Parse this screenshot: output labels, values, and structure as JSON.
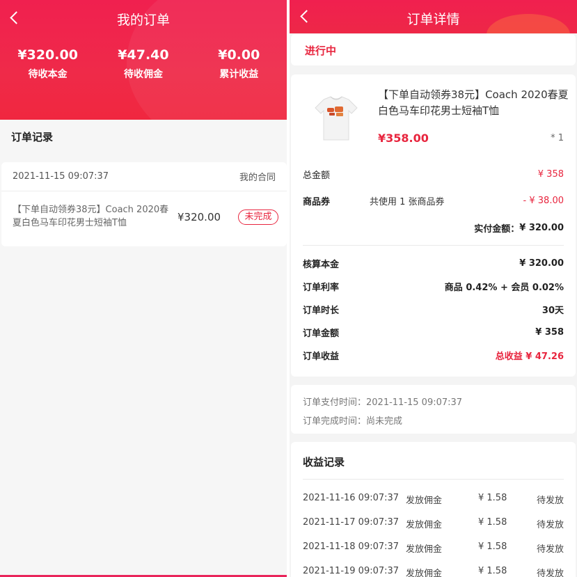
{
  "left": {
    "title": "我的订单",
    "stats": [
      {
        "value": "¥320.00",
        "label": "待收本金"
      },
      {
        "value": "¥47.40",
        "label": "待收佣金"
      },
      {
        "value": "¥0.00",
        "label": "累计收益"
      }
    ],
    "records_title": "订单记录",
    "order": {
      "time": "2021-11-15 09:07:37",
      "contract_link": "我的合同",
      "name": "【下单自动领券38元】Coach 2020春夏白色马车印花男士短袖T恤",
      "amount": "¥320.00",
      "status": "未完成"
    }
  },
  "right": {
    "title": "订单详情",
    "status": "进行中",
    "product": {
      "name": "【下单自动领券38元】Coach 2020春夏白色马车印花男士短袖T恤",
      "price": "¥358.00",
      "qty": "* 1"
    },
    "total_label": "总金额",
    "total_value": "¥ 358",
    "coupon_label": "商品券",
    "coupon_desc": "共使用 1 张商品券",
    "coupon_value": "- ¥ 38.00",
    "paid_label": "实付金额：",
    "paid_value": "¥ 320.00",
    "details": [
      {
        "label": "核算本金",
        "value": "¥ 320.00"
      },
      {
        "label": "订单利率",
        "value": "商品 0.42% + 会员 0.02%"
      },
      {
        "label": "订单时长",
        "value": "30天"
      },
      {
        "label": "订单金额",
        "value": "¥ 358"
      },
      {
        "label": "订单收益",
        "value": "总收益 ¥ 47.26"
      }
    ],
    "pay_time": "订单支付时间：2021-11-15 09:07:37",
    "finish_time": "订单完成时间：尚未完成",
    "income_title": "收益记录",
    "income_rows": [
      {
        "time": "2021-11-16 09:07:37",
        "type": "发放佣金",
        "amount": "¥ 1.58",
        "status": "待发放"
      },
      {
        "time": "2021-11-17 09:07:37",
        "type": "发放佣金",
        "amount": "¥ 1.58",
        "status": "待发放"
      },
      {
        "time": "2021-11-18 09:07:37",
        "type": "发放佣金",
        "amount": "¥ 1.58",
        "status": "待发放"
      },
      {
        "time": "2021-11-19 09:07:37",
        "type": "发放佣金",
        "amount": "¥ 1.58",
        "status": "待发放"
      }
    ]
  },
  "colors": {
    "brand_red": "#ef2450",
    "accent_red": "#e8253e"
  },
  "icons": [
    "back-arrow-icon",
    "tshirt-image"
  ]
}
